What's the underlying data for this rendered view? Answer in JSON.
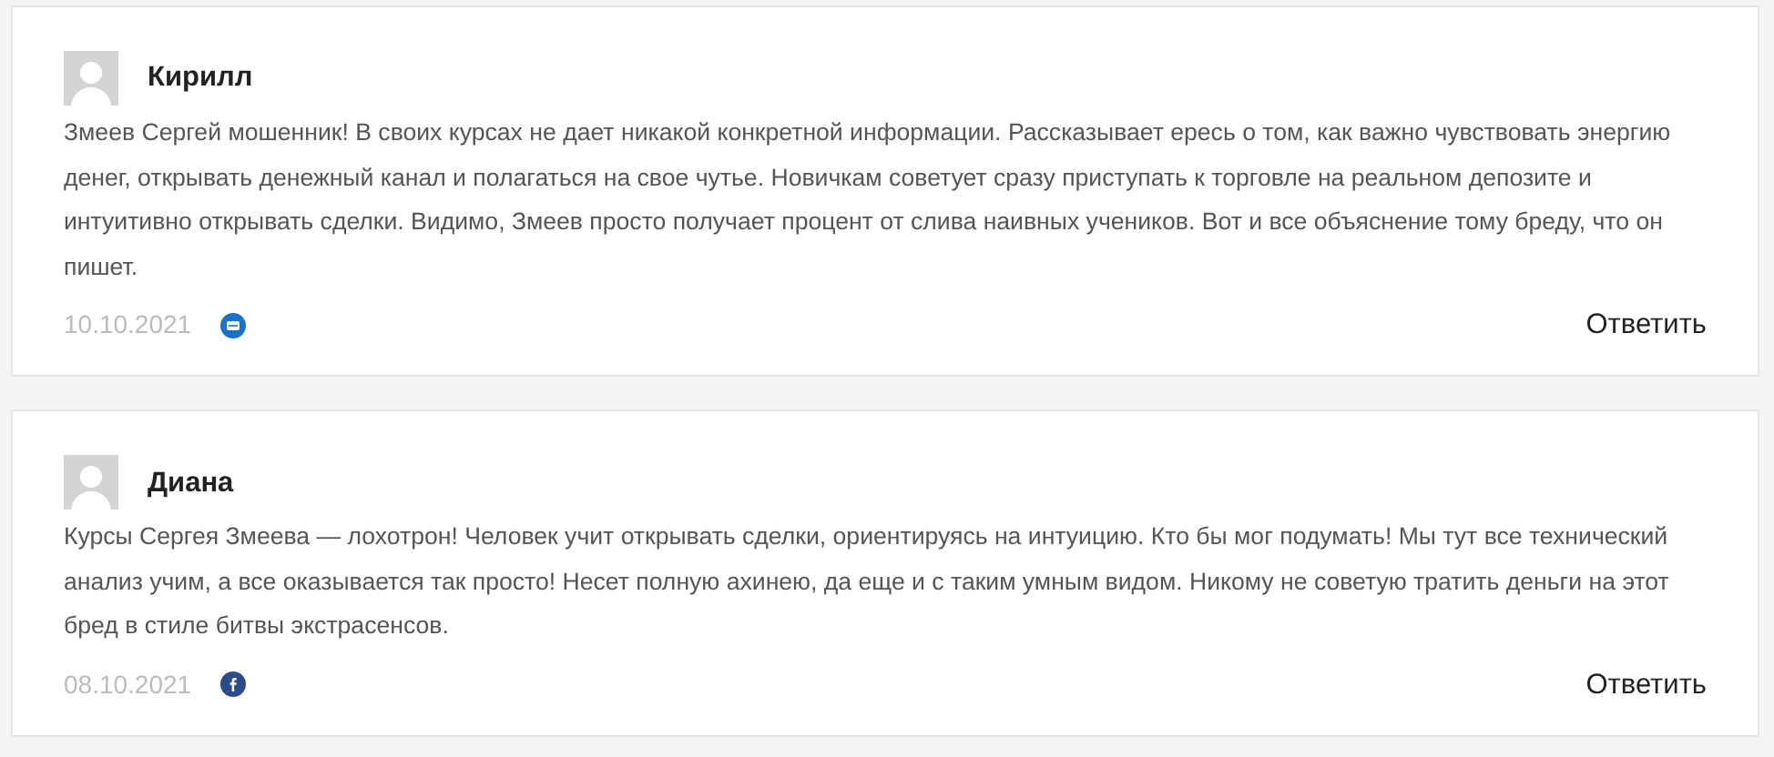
{
  "comments": [
    {
      "author": "Кирилл",
      "text": "Змеев Сергей мошенник! В своих курсах не дает никакой конкретной информации. Рассказывает ересь о том, как важно чувствовать энергию денег, открывать денежный канал и полагаться на свое чутье. Новичкам советует сразу приступать к торговле на реальном депозите и интуитивно открывать сделки. Видимо, Змеев просто получает процент от слива наивных учеников. Вот и все объяснение тому бреду, что он пишет.",
      "date": "10.10.2021",
      "kind": "mail",
      "reply": "Ответить"
    },
    {
      "author": "Диана",
      "text": "Курсы Сергея Змеева — лохотрон! Человек учит открывать сделки, ориентируясь на интуицию. Кто бы мог подумать! Мы тут все технический анализ учим, а все оказывается так просто! Несет полную ахинею, да еще и с таким умным видом. Никому не советую тратить деньги на этот бред в стиле битвы экстрасенсов.",
      "date": "08.10.2021",
      "kind": "facebook",
      "reply": "Ответить"
    }
  ]
}
